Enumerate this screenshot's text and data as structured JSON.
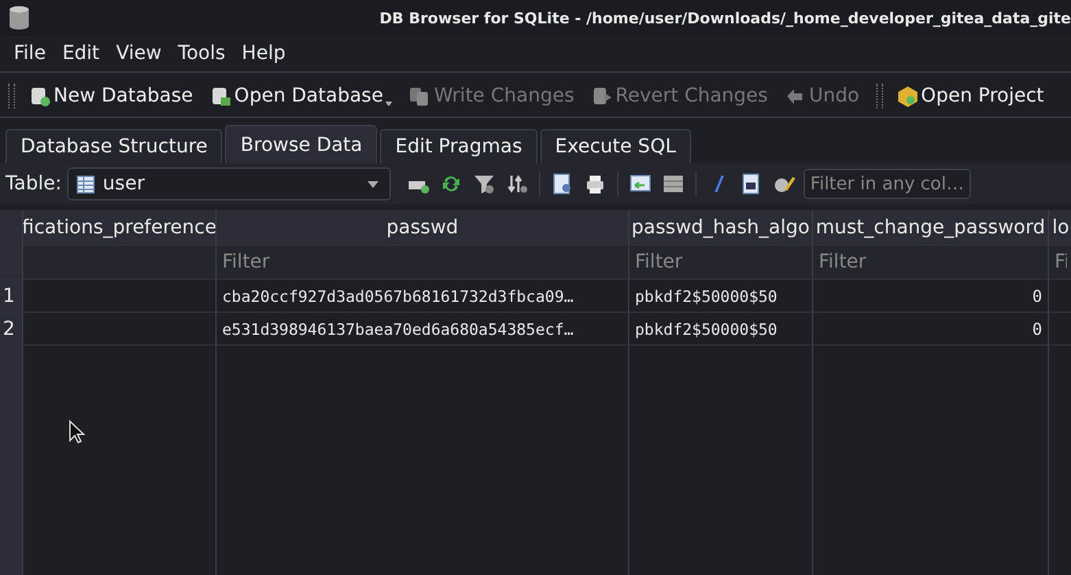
{
  "window": {
    "title": "DB Browser for SQLite - /home/user/Downloads/_home_developer_gitea_data_gite"
  },
  "menu": [
    "File",
    "Edit",
    "View",
    "Tools",
    "Help"
  ],
  "toolbar": [
    {
      "label": "New Database",
      "disabled": false,
      "kind": "new"
    },
    {
      "label": "Open Database",
      "disabled": false,
      "kind": "open"
    },
    {
      "label": "Write Changes",
      "disabled": true,
      "kind": "write"
    },
    {
      "label": "Revert Changes",
      "disabled": true,
      "kind": "revert"
    },
    {
      "label": "Undo",
      "disabled": true,
      "kind": "undo"
    },
    {
      "label": "Open Project",
      "disabled": false,
      "kind": "project"
    }
  ],
  "tabs": [
    {
      "label": "Database Structure",
      "selected": false
    },
    {
      "label": "Browse Data",
      "selected": true
    },
    {
      "label": "Edit Pragmas",
      "selected": false
    },
    {
      "label": "Execute SQL",
      "selected": false
    }
  ],
  "table_bar": {
    "label": "Table:",
    "table": "user",
    "filter_placeholder": "Filter in any col…"
  },
  "table": {
    "columns": [
      {
        "name": "fications_preference"
      },
      {
        "name": "passwd",
        "placeholder": "Filter"
      },
      {
        "name": "passwd_hash_algo",
        "placeholder": "Filter"
      },
      {
        "name": "must_change_password",
        "placeholder": "Filter"
      },
      {
        "name": "lo",
        "placeholder": "Fi"
      }
    ],
    "rows": [
      {
        "number": "1",
        "cells": [
          "",
          "cba20ccf927d3ad0567b68161732d3fbca09…",
          "pbkdf2$50000$50",
          "0",
          ""
        ]
      },
      {
        "number": "2",
        "cells": [
          "",
          "e531d398946137baea70ed6a680a54385ecf…",
          "pbkdf2$50000$50",
          "0",
          ""
        ]
      }
    ]
  }
}
